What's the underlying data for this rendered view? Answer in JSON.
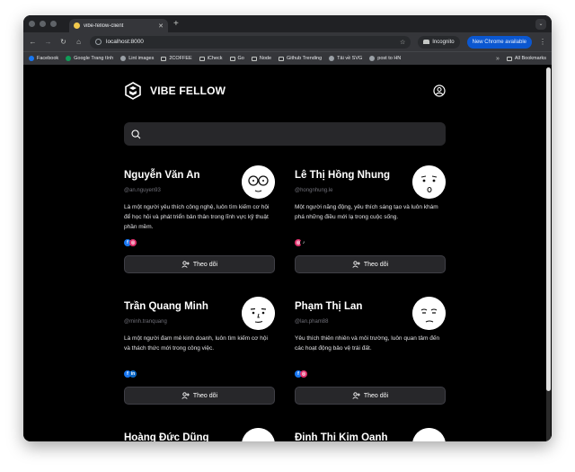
{
  "browser": {
    "tab_title": "vibe-fellow-client",
    "url": "localhost:8000",
    "incognito_label": "Incognito",
    "update_label": "New Chrome available",
    "bookmarks": [
      {
        "label": "Facebook",
        "color": "#1877f2"
      },
      {
        "label": "Google Trang tính",
        "color": "#0f9d58"
      },
      {
        "label": "Lint images",
        "color": "#9aa0a6"
      },
      {
        "label": "2COFFEE",
        "folder": true
      },
      {
        "label": "iCheck",
        "folder": true
      },
      {
        "label": "Go",
        "folder": true
      },
      {
        "label": "Node",
        "folder": true
      },
      {
        "label": "Github Trending",
        "folder": true
      },
      {
        "label": "Tải về SVG",
        "color": "#9aa0a6"
      },
      {
        "label": "post to HN",
        "color": "#9aa0a6"
      }
    ],
    "all_bookmarks_label": "All Bookmarks"
  },
  "app": {
    "brand": "VIBE FELLOW",
    "search_placeholder": ""
  },
  "users": [
    {
      "name": "Nguyễn Văn An",
      "handle": "@an.nguyen93",
      "bio": "Là một người yêu thích công nghệ, luôn tìm kiếm cơ hội để học hỏi và phát triển bản thân trong lĩnh vực kỹ thuật phần mềm.",
      "socials": [
        "facebook",
        "instagram"
      ],
      "follow_label": "Theo dõi"
    },
    {
      "name": "Lê Thị Hồng Nhung",
      "handle": "@hongnhung.le",
      "bio": "Một người năng động, yêu thích sáng tạo và luôn khám phá những điều mới lạ trong cuộc sống.",
      "socials": [
        "instagram",
        "tiktok"
      ],
      "follow_label": "Theo dõi"
    },
    {
      "name": "Trần Quang Minh",
      "handle": "@minh.tranquang",
      "bio": "Là một người đam mê kinh doanh, luôn tìm kiếm cơ hội và thách thức mới trong công việc.",
      "socials": [
        "facebook",
        "linkedin"
      ],
      "follow_label": "Theo dõi"
    },
    {
      "name": "Phạm Thị Lan",
      "handle": "@lan.pham88",
      "bio": "Yêu thích thiên nhiên và môi trường, luôn quan tâm đến các hoạt động bảo vệ trái đất.",
      "socials": [
        "facebook",
        "instagram"
      ],
      "follow_label": "Theo dõi"
    },
    {
      "name": "Hoàng Đức Dũng",
      "handle": "",
      "bio": "",
      "socials": [],
      "follow_label": ""
    },
    {
      "name": "Đinh Thị Kim Oanh",
      "handle": "",
      "bio": "",
      "socials": [],
      "follow_label": ""
    }
  ],
  "colors": {
    "background": "#000000",
    "card_button": "#27272a",
    "facebook": "#1877f2",
    "instagram": "#e1306c",
    "linkedin": "#0a66c2",
    "tiktok": "#ffffff"
  }
}
